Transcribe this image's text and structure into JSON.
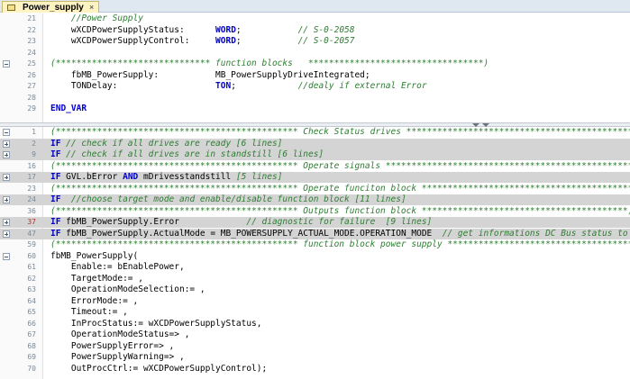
{
  "tab": {
    "label": "Power_supply",
    "close": "×",
    "icon": "pou-icon"
  },
  "top_lines": [
    {
      "n": "21",
      "fold": "",
      "hl": false,
      "red": false,
      "tokens": [
        [
          "c",
          "    //Power Supply"
        ]
      ]
    },
    {
      "n": "22",
      "fold": "",
      "hl": false,
      "red": false,
      "tokens": [
        [
          "p",
          "    wXCDPowerSupplyStatus:      "
        ],
        [
          "k",
          "WORD"
        ],
        [
          "p",
          ";           "
        ],
        [
          "c",
          "// S-0-2058"
        ]
      ]
    },
    {
      "n": "23",
      "fold": "",
      "hl": false,
      "red": false,
      "tokens": [
        [
          "p",
          "    wXCDPowerSupplyControl:     "
        ],
        [
          "k",
          "WORD"
        ],
        [
          "p",
          ";           "
        ],
        [
          "c",
          "// S-0-2057"
        ]
      ]
    },
    {
      "n": "24",
      "fold": "",
      "hl": false,
      "red": false,
      "tokens": []
    },
    {
      "n": "25",
      "fold": "minus",
      "hl": false,
      "red": false,
      "tokens": [
        [
          "c",
          "(****************************** function blocks   **********************************)"
        ]
      ]
    },
    {
      "n": "26",
      "fold": "",
      "hl": false,
      "red": false,
      "tokens": [
        [
          "p",
          "    fbMB_PowerSupply:           MB_PowerSupplyDriveIntegrated;"
        ]
      ]
    },
    {
      "n": "27",
      "fold": "",
      "hl": false,
      "red": false,
      "tokens": [
        [
          "p",
          "    TONDelay:                   "
        ],
        [
          "k",
          "TON"
        ],
        [
          "p",
          ";            "
        ],
        [
          "c",
          "//dealy if external Error"
        ]
      ]
    },
    {
      "n": "28",
      "fold": "",
      "hl": false,
      "red": false,
      "tokens": []
    },
    {
      "n": "29",
      "fold": "",
      "hl": false,
      "red": false,
      "tokens": [
        [
          "k",
          "END_VAR"
        ]
      ]
    }
  ],
  "bottom_lines": [
    {
      "n": "1",
      "fold": "minus",
      "hl": false,
      "red": false,
      "tokens": [
        [
          "c",
          "(*********************************************** Check Status drives *********************************************)"
        ]
      ]
    },
    {
      "n": "2",
      "fold": "plus",
      "hl": true,
      "red": false,
      "tokens": [
        [
          "k",
          "IF"
        ],
        [
          "c",
          " // check if all drives are ready [6 lines]"
        ]
      ]
    },
    {
      "n": "9",
      "fold": "plus",
      "hl": true,
      "red": false,
      "tokens": [
        [
          "k",
          "IF"
        ],
        [
          "c",
          " // check if all drives are in standstill [6 lines]"
        ]
      ]
    },
    {
      "n": "16",
      "fold": "",
      "hl": false,
      "red": false,
      "tokens": [
        [
          "c",
          "(*********************************************** Operate signals *************************************************)"
        ]
      ]
    },
    {
      "n": "17",
      "fold": "plus",
      "hl": true,
      "red": false,
      "tokens": [
        [
          "k",
          "IF"
        ],
        [
          "p",
          " GVL.bError "
        ],
        [
          "k",
          "AND"
        ],
        [
          "p",
          " mDrivesstandstill "
        ],
        [
          "c",
          "[5 lines]"
        ]
      ]
    },
    {
      "n": "23",
      "fold": "",
      "hl": false,
      "red": false,
      "tokens": [
        [
          "c",
          "(*********************************************** Operate funciton block *****************************************)"
        ]
      ]
    },
    {
      "n": "24",
      "fold": "plus",
      "hl": true,
      "red": false,
      "tokens": [
        [
          "k",
          "IF"
        ],
        [
          "c",
          "  //choose target mode and enable/disable function block [11 lines]"
        ]
      ]
    },
    {
      "n": "36",
      "fold": "",
      "hl": false,
      "red": false,
      "tokens": [
        [
          "c",
          "(*********************************************** Outputs function block ****************************************)"
        ]
      ]
    },
    {
      "n": "37",
      "fold": "plus",
      "hl": true,
      "red": true,
      "tokens": [
        [
          "k",
          "IF"
        ],
        [
          "p",
          " fbMB_PowerSupply.Error             "
        ],
        [
          "c",
          "// diagnostic for failure  [9 lines]"
        ]
      ]
    },
    {
      "n": "47",
      "fold": "plus",
      "hl": true,
      "red": false,
      "tokens": [
        [
          "k",
          "IF"
        ],
        [
          "p",
          " fbMB_PowerSupply.ActualMode = MB_POWERSUPPLY_ACTUAL_MODE.OPERATION_MODE  "
        ],
        [
          "c",
          "// get informations DC Bus status to the drives"
        ]
      ]
    },
    {
      "n": "59",
      "fold": "",
      "hl": false,
      "red": false,
      "tokens": [
        [
          "c",
          "(*********************************************** function block power supply *************************************)"
        ]
      ]
    },
    {
      "n": "60",
      "fold": "minus",
      "hl": false,
      "red": false,
      "tokens": [
        [
          "p",
          "fbMB_PowerSupply("
        ]
      ]
    },
    {
      "n": "61",
      "fold": "",
      "hl": false,
      "red": false,
      "tokens": [
        [
          "p",
          "    Enable:= bEnablePower,"
        ]
      ]
    },
    {
      "n": "62",
      "fold": "",
      "hl": false,
      "red": false,
      "tokens": [
        [
          "p",
          "    TargetMode:= ,"
        ]
      ]
    },
    {
      "n": "63",
      "fold": "",
      "hl": false,
      "red": false,
      "tokens": [
        [
          "p",
          "    OperationModeSelection:= ,"
        ]
      ]
    },
    {
      "n": "64",
      "fold": "",
      "hl": false,
      "red": false,
      "tokens": [
        [
          "p",
          "    ErrorMode:= ,"
        ]
      ]
    },
    {
      "n": "65",
      "fold": "",
      "hl": false,
      "red": false,
      "tokens": [
        [
          "p",
          "    Timeout:= ,"
        ]
      ]
    },
    {
      "n": "66",
      "fold": "",
      "hl": false,
      "red": false,
      "tokens": [
        [
          "p",
          "    InProcStatus:= wXCDPowerSupplyStatus,"
        ]
      ]
    },
    {
      "n": "67",
      "fold": "",
      "hl": false,
      "red": false,
      "tokens": [
        [
          "p",
          "    OperationModeStatus=> ,"
        ]
      ]
    },
    {
      "n": "68",
      "fold": "",
      "hl": false,
      "red": false,
      "tokens": [
        [
          "p",
          "    PowerSupplyError=> ,"
        ]
      ]
    },
    {
      "n": "69",
      "fold": "",
      "hl": false,
      "red": false,
      "tokens": [
        [
          "p",
          "    PowerSupplyWarning=> ,"
        ]
      ]
    },
    {
      "n": "70",
      "fold": "",
      "hl": false,
      "red": false,
      "tokens": [
        [
          "p",
          "    OutProcCtrl:= wXCDPowerSupplyControl);"
        ]
      ]
    }
  ],
  "colors": {
    "keyword": "#0000c8",
    "comment": "#2e7d32",
    "highlight": "#d4d4d4",
    "tab": "#fff3c2",
    "line_number_breakpoint": "#b0302c"
  },
  "icons": [
    "pou-icon",
    "close-icon",
    "fold-plus-icon",
    "fold-minus-icon",
    "splitter-arrow-icon"
  ]
}
